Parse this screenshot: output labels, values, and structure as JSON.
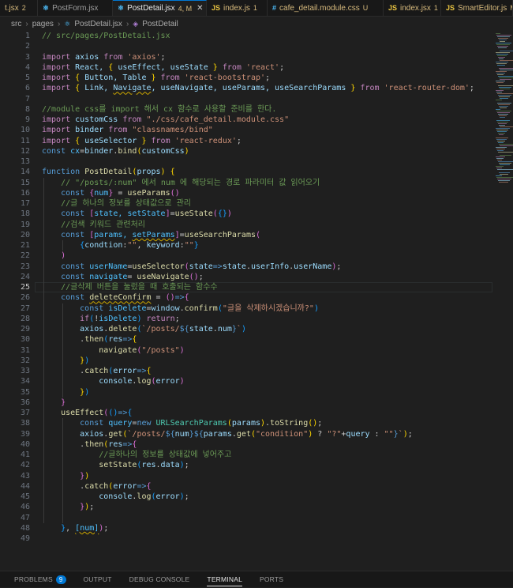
{
  "tabs": [
    {
      "icon": "",
      "label": "t.jsx",
      "badge": "2",
      "color": "#d7ba7d"
    },
    {
      "icon": "⚛",
      "label": "PostForm.jsx",
      "badge": "",
      "color": "#4fc1ff"
    },
    {
      "icon": "⚛",
      "label": "PostDetail.jsx",
      "badge": "4, M",
      "color": "#4fc1ff",
      "active": true,
      "close": "✕"
    },
    {
      "icon": "JS",
      "label": "index.js",
      "badge": "1",
      "color": "#e8c341"
    },
    {
      "icon": "#",
      "label": "cafe_detail.module.css",
      "badge": "U",
      "color": "#4fc1ff"
    },
    {
      "icon": "JS",
      "label": "index.jsx",
      "badge": "1",
      "color": "#e8c341"
    },
    {
      "icon": "JS",
      "label": "SmartEditor.js",
      "badge": "M",
      "color": "#e8c341"
    }
  ],
  "breadcrumb": [
    "src",
    "pages",
    "PostDetail.jsx",
    "PostDetail"
  ],
  "current_line": 25,
  "lines": [
    {
      "n": "1",
      "s": [
        [
          "// src/pages/PostDetail.jsx",
          "com"
        ]
      ]
    },
    {
      "n": "2",
      "s": []
    },
    {
      "n": "3",
      "s": [
        [
          "import",
          "ctl"
        ],
        [
          " axios ",
          "var"
        ],
        [
          "from",
          "ctl"
        ],
        [
          " 'axios'",
          "str"
        ],
        [
          ";",
          "pun"
        ]
      ]
    },
    {
      "n": "4",
      "s": [
        [
          "import",
          "ctl"
        ],
        [
          " React, ",
          "var"
        ],
        [
          "{ ",
          "p1"
        ],
        [
          "useEffect, useState ",
          "var"
        ],
        [
          "}",
          "p1"
        ],
        [
          " from",
          "ctl"
        ],
        [
          " 'react'",
          "str"
        ],
        [
          ";",
          "pun"
        ]
      ]
    },
    {
      "n": "5",
      "s": [
        [
          "import",
          "ctl"
        ],
        [
          " ",
          "pun"
        ],
        [
          "{ ",
          "p1"
        ],
        [
          "Button, Table ",
          "var"
        ],
        [
          "}",
          "p1"
        ],
        [
          " from",
          "ctl"
        ],
        [
          " 'react-bootstrap'",
          "str"
        ],
        [
          ";",
          "pun"
        ]
      ]
    },
    {
      "n": "6",
      "s": [
        [
          "import",
          "ctl"
        ],
        [
          " ",
          "pun"
        ],
        [
          "{ ",
          "p1"
        ],
        [
          "Link, ",
          "var"
        ],
        [
          "Navigate",
          "var",
          "squig"
        ],
        [
          ", useNavigate, useParams, useSearchParams ",
          "var"
        ],
        [
          "}",
          "p1"
        ],
        [
          " from",
          "ctl"
        ],
        [
          " 'react-router-dom'",
          "str"
        ],
        [
          ";",
          "pun"
        ]
      ]
    },
    {
      "n": "7",
      "s": []
    },
    {
      "n": "8",
      "s": [
        [
          "//module css를 import 해서 cx 함수로 사용할 준비를 한다.",
          "com"
        ]
      ]
    },
    {
      "n": "9",
      "s": [
        [
          "import",
          "ctl"
        ],
        [
          " customCss ",
          "var"
        ],
        [
          "from",
          "ctl"
        ],
        [
          " \"./css/cafe_detail.module.css\"",
          "str"
        ]
      ]
    },
    {
      "n": "10",
      "s": [
        [
          "import",
          "ctl"
        ],
        [
          " binder ",
          "var"
        ],
        [
          "from",
          "ctl"
        ],
        [
          " \"classnames/bind\"",
          "str"
        ]
      ]
    },
    {
      "n": "11",
      "s": [
        [
          "import",
          "ctl"
        ],
        [
          " ",
          "pun"
        ],
        [
          "{ ",
          "p1"
        ],
        [
          "useSelector ",
          "var"
        ],
        [
          "}",
          "p1"
        ],
        [
          " from",
          "ctl"
        ],
        [
          " 'react-redux'",
          "str"
        ],
        [
          ";",
          "pun"
        ]
      ]
    },
    {
      "n": "12",
      "s": [
        [
          "const",
          "kw"
        ],
        [
          " cx",
          "con"
        ],
        [
          "=",
          "pun"
        ],
        [
          "binder",
          "var"
        ],
        [
          ".",
          "pun"
        ],
        [
          "bind",
          "fn"
        ],
        [
          "(",
          "p1"
        ],
        [
          "customCss",
          "var"
        ],
        [
          ")",
          "p1"
        ]
      ]
    },
    {
      "n": "13",
      "s": []
    },
    {
      "n": "14",
      "s": [
        [
          "function",
          "kw"
        ],
        [
          " PostDetail",
          "fn"
        ],
        [
          "(",
          "p1"
        ],
        [
          "props",
          "var"
        ],
        [
          ")",
          "p1"
        ],
        [
          " {",
          "p1"
        ]
      ]
    },
    {
      "n": "15",
      "s": [
        [
          "    // \"/posts/:num\" 에서 num 에 해당되는 경로 파라미터 값 읽어오기",
          "com"
        ]
      ]
    },
    {
      "n": "16",
      "s": [
        [
          "    const",
          "kw"
        ],
        [
          " ",
          "pun"
        ],
        [
          "{",
          "p2"
        ],
        [
          "num",
          "con"
        ],
        [
          "}",
          "p2"
        ],
        [
          " = ",
          "pun"
        ],
        [
          "useParams",
          "fn"
        ],
        [
          "()",
          "p2"
        ]
      ]
    },
    {
      "n": "17",
      "s": [
        [
          "    //글 하나의 정보를 상태값으로 관리",
          "com"
        ]
      ]
    },
    {
      "n": "18",
      "s": [
        [
          "    const",
          "kw"
        ],
        [
          " ",
          "pun"
        ],
        [
          "[",
          "p2"
        ],
        [
          "state, setState",
          "con"
        ],
        [
          "]",
          "p2"
        ],
        [
          "=",
          "pun"
        ],
        [
          "useState",
          "fn"
        ],
        [
          "(",
          "p2"
        ],
        [
          "{}",
          "p3"
        ],
        [
          ")",
          "p2"
        ]
      ]
    },
    {
      "n": "19",
      "s": [
        [
          "    //검색 키워드 관련처리",
          "com"
        ]
      ]
    },
    {
      "n": "20",
      "s": [
        [
          "    const",
          "kw"
        ],
        [
          " ",
          "pun"
        ],
        [
          "[",
          "p2"
        ],
        [
          "params, ",
          "con"
        ],
        [
          "setParams",
          "con",
          "squig"
        ],
        [
          "]",
          "p2"
        ],
        [
          "=",
          "pun"
        ],
        [
          "useSearchParams",
          "fn"
        ],
        [
          "(",
          "p2"
        ]
      ]
    },
    {
      "n": "21",
      "s": [
        [
          "        ",
          "pun"
        ],
        [
          "{",
          "p3"
        ],
        [
          "condtion",
          "var"
        ],
        [
          ":",
          "pun"
        ],
        [
          "\"\"",
          "str"
        ],
        [
          ", ",
          "pun"
        ],
        [
          "keyword",
          "var"
        ],
        [
          ":",
          "pun"
        ],
        [
          "\"\"",
          "str"
        ],
        [
          "}",
          "p3"
        ]
      ]
    },
    {
      "n": "22",
      "s": [
        [
          "    ",
          "pun"
        ],
        [
          ")",
          "p2"
        ]
      ]
    },
    {
      "n": "23",
      "s": [
        [
          "    const",
          "kw"
        ],
        [
          " userName",
          "con"
        ],
        [
          "=",
          "pun"
        ],
        [
          "useSelector",
          "fn"
        ],
        [
          "(",
          "p2"
        ],
        [
          "state",
          "var"
        ],
        [
          "=>",
          "kw"
        ],
        [
          "state",
          "var"
        ],
        [
          ".",
          "pun"
        ],
        [
          "userInfo",
          "var"
        ],
        [
          ".",
          "pun"
        ],
        [
          "userName",
          "var"
        ],
        [
          ")",
          "p2"
        ],
        [
          ";",
          "pun"
        ]
      ]
    },
    {
      "n": "24",
      "s": [
        [
          "    const",
          "kw"
        ],
        [
          " navigate",
          "con"
        ],
        [
          "= ",
          "pun"
        ],
        [
          "useNavigate",
          "fn"
        ],
        [
          "()",
          "p2"
        ],
        [
          ";",
          "pun"
        ]
      ]
    },
    {
      "n": "25",
      "s": [
        [
          "    //글삭제 버튼을 눌렀을 때 호출되는 함수수",
          "com"
        ]
      ]
    },
    {
      "n": "26",
      "s": [
        [
          "    const",
          "kw"
        ],
        [
          " ",
          "pun"
        ],
        [
          "deleteConfirm",
          "fn",
          "squig"
        ],
        [
          " = ",
          "pun"
        ],
        [
          "()",
          "p2"
        ],
        [
          "=>",
          "kw"
        ],
        [
          "{",
          "p2"
        ]
      ]
    },
    {
      "n": "27",
      "s": [
        [
          "        const",
          "kw"
        ],
        [
          " isDelete",
          "con"
        ],
        [
          "=",
          "pun"
        ],
        [
          "window",
          "var"
        ],
        [
          ".",
          "pun"
        ],
        [
          "confirm",
          "fn"
        ],
        [
          "(",
          "p3"
        ],
        [
          "\"글을 삭제하시겠습니까?\"",
          "str"
        ],
        [
          ")",
          "p3"
        ]
      ]
    },
    {
      "n": "28",
      "s": [
        [
          "        if",
          "ctl"
        ],
        [
          "(",
          "p3"
        ],
        [
          "!",
          "pun"
        ],
        [
          "isDelete",
          "con"
        ],
        [
          ")",
          "p3"
        ],
        [
          " return",
          "ctl"
        ],
        [
          ";",
          "pun"
        ]
      ]
    },
    {
      "n": "29",
      "s": [
        [
          "        axios",
          "var"
        ],
        [
          ".",
          "pun"
        ],
        [
          "delete",
          "fn"
        ],
        [
          "(",
          "p3"
        ],
        [
          "`/posts/",
          "str"
        ],
        [
          "${",
          "kw"
        ],
        [
          "state",
          "var"
        ],
        [
          ".",
          "pun"
        ],
        [
          "num",
          "var"
        ],
        [
          "}",
          "kw"
        ],
        [
          "`",
          "str"
        ],
        [
          ")",
          "p3"
        ]
      ]
    },
    {
      "n": "30",
      "s": [
        [
          "        .",
          "pun"
        ],
        [
          "then",
          "fn"
        ],
        [
          "(",
          "p3"
        ],
        [
          "res",
          "var"
        ],
        [
          "=>",
          "kw"
        ],
        [
          "{",
          "p1"
        ]
      ]
    },
    {
      "n": "31",
      "s": [
        [
          "            navigate",
          "fn"
        ],
        [
          "(",
          "p2"
        ],
        [
          "\"/posts\"",
          "str"
        ],
        [
          ")",
          "p2"
        ]
      ]
    },
    {
      "n": "32",
      "s": [
        [
          "        ",
          "pun"
        ],
        [
          "}",
          "p1"
        ],
        [
          ")",
          "p3"
        ]
      ]
    },
    {
      "n": "33",
      "s": [
        [
          "        .",
          "pun"
        ],
        [
          "catch",
          "fn"
        ],
        [
          "(",
          "p3"
        ],
        [
          "error",
          "var"
        ],
        [
          "=>",
          "kw"
        ],
        [
          "{",
          "p1"
        ]
      ]
    },
    {
      "n": "34",
      "s": [
        [
          "            console",
          "var"
        ],
        [
          ".",
          "pun"
        ],
        [
          "log",
          "fn"
        ],
        [
          "(",
          "p2"
        ],
        [
          "error",
          "var"
        ],
        [
          ")",
          "p2"
        ]
      ]
    },
    {
      "n": "35",
      "s": [
        [
          "        ",
          "pun"
        ],
        [
          "}",
          "p1"
        ],
        [
          ")",
          "p3"
        ]
      ]
    },
    {
      "n": "36",
      "s": [
        [
          "    ",
          "pun"
        ],
        [
          "}",
          "p2"
        ]
      ]
    },
    {
      "n": "37",
      "s": [
        [
          "    useEffect",
          "fn"
        ],
        [
          "(",
          "p2"
        ],
        [
          "()",
          "p3"
        ],
        [
          "=>",
          "kw"
        ],
        [
          "{",
          "p3"
        ]
      ]
    },
    {
      "n": "38",
      "s": [
        [
          "        const",
          "kw"
        ],
        [
          " query",
          "con"
        ],
        [
          "=",
          "pun"
        ],
        [
          "new",
          "kw"
        ],
        [
          " URLSearchParams",
          "cls"
        ],
        [
          "(",
          "p1"
        ],
        [
          "params",
          "var"
        ],
        [
          ")",
          "p1"
        ],
        [
          ".",
          "pun"
        ],
        [
          "toString",
          "fn"
        ],
        [
          "()",
          "p1"
        ],
        [
          ";",
          "pun"
        ]
      ]
    },
    {
      "n": "39",
      "s": [
        [
          "        axios",
          "var"
        ],
        [
          ".",
          "pun"
        ],
        [
          "get",
          "fn"
        ],
        [
          "(",
          "p1"
        ],
        [
          "`/posts/",
          "str"
        ],
        [
          "${",
          "kw"
        ],
        [
          "num",
          "var"
        ],
        [
          "}${",
          "kw"
        ],
        [
          "params",
          "var"
        ],
        [
          ".",
          "pun"
        ],
        [
          "get",
          "fn"
        ],
        [
          "(",
          "p1"
        ],
        [
          "\"condition\"",
          "str"
        ],
        [
          ")",
          "p1"
        ],
        [
          " ? ",
          "pun"
        ],
        [
          "\"?\"",
          "str"
        ],
        [
          "+",
          "pun"
        ],
        [
          "query",
          "var"
        ],
        [
          " : ",
          "pun"
        ],
        [
          "\"\"",
          "str"
        ],
        [
          "}",
          "kw"
        ],
        [
          "`",
          "str"
        ],
        [
          ")",
          "p1"
        ],
        [
          ";",
          "pun"
        ]
      ]
    },
    {
      "n": "40",
      "s": [
        [
          "        .",
          "pun"
        ],
        [
          "then",
          "fn"
        ],
        [
          "(",
          "p1"
        ],
        [
          "res",
          "var"
        ],
        [
          "=>",
          "kw"
        ],
        [
          "{",
          "p2"
        ]
      ]
    },
    {
      "n": "41",
      "s": [
        [
          "            //글하나의 정보를 상태값에 넣어주고",
          "com"
        ]
      ]
    },
    {
      "n": "42",
      "s": [
        [
          "            setState",
          "fn"
        ],
        [
          "(",
          "p3"
        ],
        [
          "res",
          "var"
        ],
        [
          ".",
          "pun"
        ],
        [
          "data",
          "var"
        ],
        [
          ")",
          "p3"
        ],
        [
          ";",
          "pun"
        ]
      ]
    },
    {
      "n": "43",
      "s": [
        [
          "        ",
          "pun"
        ],
        [
          "}",
          "p2"
        ],
        [
          ")",
          "p1"
        ]
      ]
    },
    {
      "n": "44",
      "s": [
        [
          "        .",
          "pun"
        ],
        [
          "catch",
          "fn"
        ],
        [
          "(",
          "p1"
        ],
        [
          "error",
          "var"
        ],
        [
          "=>",
          "kw"
        ],
        [
          "{",
          "p2"
        ]
      ]
    },
    {
      "n": "45",
      "s": [
        [
          "            console",
          "var"
        ],
        [
          ".",
          "pun"
        ],
        [
          "log",
          "fn"
        ],
        [
          "(",
          "p3"
        ],
        [
          "error",
          "var"
        ],
        [
          ")",
          "p3"
        ],
        [
          ";",
          "pun"
        ]
      ]
    },
    {
      "n": "46",
      "s": [
        [
          "        ",
          "pun"
        ],
        [
          "}",
          "p2"
        ],
        [
          ")",
          "p1"
        ],
        [
          ";",
          "pun"
        ]
      ]
    },
    {
      "n": "47",
      "s": []
    },
    {
      "n": "48",
      "s": [
        [
          "    ",
          "pun"
        ],
        [
          "}",
          "p3"
        ],
        [
          ", ",
          "pun"
        ],
        [
          "[num]",
          "con",
          "squig"
        ],
        [
          ")",
          "p2"
        ],
        [
          ";",
          "pun"
        ]
      ]
    },
    {
      "n": "49",
      "s": []
    }
  ],
  "panel_tabs": [
    {
      "label": "PROBLEMS",
      "badge": "9"
    },
    {
      "label": "OUTPUT"
    },
    {
      "label": "DEBUG CONSOLE"
    },
    {
      "label": "TERMINAL",
      "active": true
    },
    {
      "label": "PORTS"
    }
  ]
}
